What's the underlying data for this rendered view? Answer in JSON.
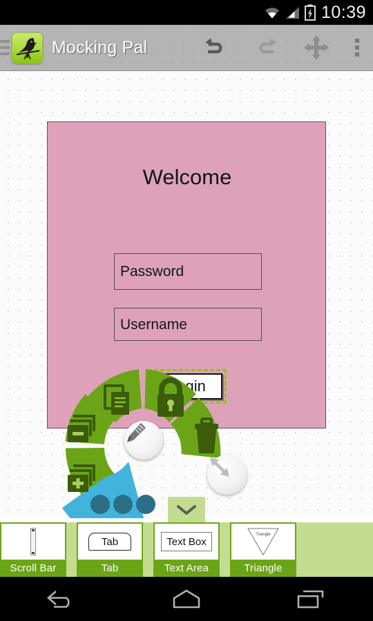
{
  "status_bar": {
    "time": "10:39",
    "icons": [
      "wifi-icon",
      "cellular-signal-icon",
      "battery-charging-icon"
    ]
  },
  "action_bar": {
    "app_title": "Mocking Pal",
    "logo_alt": "mockingbird-logo",
    "drawer_icon": "hamburger-menu-icon",
    "buttons": [
      {
        "name": "undo-button",
        "icon": "undo-arrow-icon",
        "enabled": true
      },
      {
        "name": "redo-button",
        "icon": "redo-arrow-icon",
        "enabled": false
      },
      {
        "name": "pan-button",
        "icon": "move-four-arrows-icon",
        "enabled": true
      },
      {
        "name": "overflow-button",
        "icon": "vertical-dots-icon",
        "enabled": true
      }
    ]
  },
  "canvas": {
    "background": "#fbfbfb",
    "dot_grid": true,
    "mockup": {
      "fill": "#dda2b9",
      "border": "#6a4a56",
      "title": "Welcome",
      "fields": [
        {
          "name": "password-field",
          "text": "Password"
        },
        {
          "name": "username-field",
          "text": "Username"
        }
      ],
      "button": {
        "name": "login-button",
        "label": "Login",
        "selected": true
      },
      "selection_color": "#8fc31f"
    }
  },
  "radial_menu": {
    "open": true,
    "segment_color": "#6ba517",
    "segment_icon_color": "#3a5c0b",
    "more_color": "#41b3dd",
    "more_dot_color": "#2b6e85",
    "segments": [
      {
        "name": "duplicate-action",
        "icon": "copy-documents-icon"
      },
      {
        "name": "lock-action",
        "icon": "lock-icon"
      },
      {
        "name": "delete-action",
        "icon": "trash-can-icon"
      },
      {
        "name": "send-backward-action",
        "icon": "layer-minus-icon"
      },
      {
        "name": "bring-forward-action",
        "icon": "layer-plus-icon"
      },
      {
        "name": "more-options-action",
        "icon": "three-dots-icon"
      }
    ],
    "center_button": {
      "name": "edit-button",
      "icon": "pencil-icon"
    },
    "resize_handle": {
      "name": "resize-handle",
      "icon": "diagonal-resize-arrow-icon"
    }
  },
  "palette": {
    "background": "#c4dc92",
    "item_color": "#6ba517",
    "collapse_icon": "chevron-down-icon",
    "items": [
      {
        "label": "Scroll Bar",
        "thumb": "scrollbar-thumbnail",
        "thumb_text": ""
      },
      {
        "label": "Tab",
        "thumb": "tab-thumbnail",
        "thumb_text": "Tab"
      },
      {
        "label": "Text Area",
        "thumb": "textbox-thumbnail",
        "thumb_text": "Text Box"
      },
      {
        "label": "Triangle",
        "thumb": "triangle-thumbnail",
        "thumb_text": "Triangle"
      }
    ]
  },
  "nav_bar": {
    "buttons": [
      {
        "name": "back-button",
        "icon": "back-arrow-icon"
      },
      {
        "name": "home-button",
        "icon": "home-icon"
      },
      {
        "name": "recents-button",
        "icon": "recents-squares-icon"
      }
    ]
  }
}
